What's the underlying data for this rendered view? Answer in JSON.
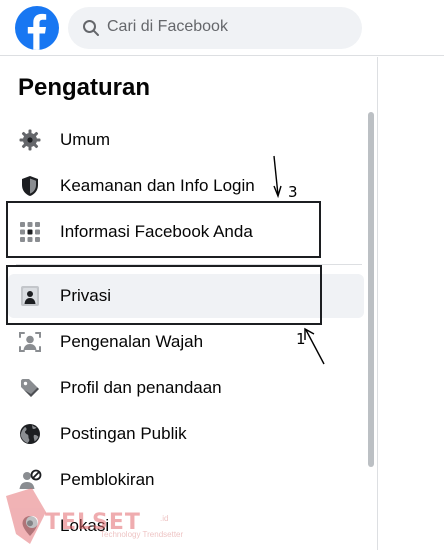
{
  "header": {
    "logo_icon": "facebook-logo",
    "search_placeholder": "Cari di Facebook",
    "brand_color": "#1877f2"
  },
  "sidebar": {
    "title": "Pengaturan",
    "items": [
      {
        "label": "Umum",
        "icon": "gear-icon"
      },
      {
        "label": "Keamanan dan Info Login",
        "icon": "shield-icon"
      },
      {
        "label": "Informasi Facebook Anda",
        "icon": "grid-icon"
      },
      {
        "label": "Privasi",
        "icon": "lock-icon"
      },
      {
        "label": "Pengenalan Wajah",
        "icon": "face-recognition-icon"
      },
      {
        "label": "Profil dan penandaan",
        "icon": "tag-icon"
      },
      {
        "label": "Postingan Publik",
        "icon": "globe-icon"
      },
      {
        "label": "Pemblokiran",
        "icon": "block-user-icon"
      },
      {
        "label": "Lokasi",
        "icon": "location-pin-icon"
      }
    ]
  },
  "annotations": {
    "marker_1": "1",
    "marker_3": "3"
  },
  "watermark": {
    "text": "TELSET",
    "suffix": ".id",
    "tagline": "Technology Trendsetter"
  }
}
